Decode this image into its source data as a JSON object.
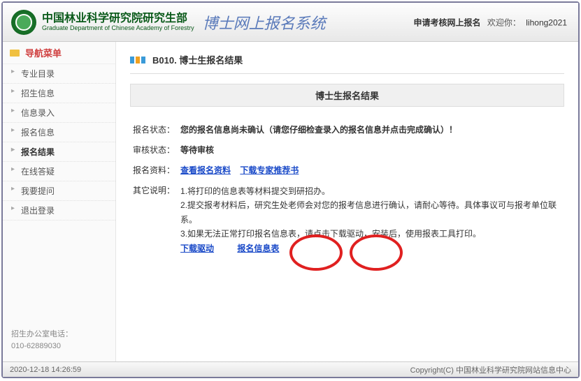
{
  "header": {
    "org_cn": "中国林业科学研究院研究生部",
    "org_en": "Graduate Department of Chinese Academy of Forestry",
    "system_name": "博士网上报名系统",
    "apply_label": "申请考核网上报名",
    "welcome_label": "欢迎你：",
    "username": "lihong2021"
  },
  "sidebar": {
    "nav_title": "导航菜单",
    "items": [
      {
        "label": "专业目录",
        "active": false
      },
      {
        "label": "招生信息",
        "active": false
      },
      {
        "label": "信息录入",
        "active": false
      },
      {
        "label": "报名信息",
        "active": false
      },
      {
        "label": "报名结果",
        "active": true
      },
      {
        "label": "在线答疑",
        "active": false
      },
      {
        "label": "我要提问",
        "active": false
      },
      {
        "label": "退出登录",
        "active": false
      }
    ],
    "office_label": "招生办公室电话：",
    "office_phone": "010-62889030"
  },
  "main": {
    "breadcrumb": "B010. 博士生报名结果",
    "section_title": "博士生报名结果",
    "rows": {
      "status_label": "报名状态：",
      "status_value": "您的报名信息尚未确认（请您仔细检查录入的报名信息并点击完成确认）！",
      "review_label": "审核状态：",
      "review_value": "等待审核",
      "material_label": "报名资料：",
      "material_link1": "查看报名资料",
      "material_link2": "下载专家推荐书",
      "notes_label": "其它说明：",
      "note1": "1.将打印的信息表等材料提交到研招办。",
      "note2": "2.提交报考材料后，研究生处老师会对您的报考信息进行确认，请耐心等待。具体事议可与报考单位联系。",
      "note3_prefix": "3.如果无法正常打印报名信息表，请点击下载驱动，安装后，使用报表工具打印。",
      "download_driver": "下载驱动",
      "info_form": "报名信息表"
    }
  },
  "footer": {
    "timestamp": "2020-12-18 14:26:59",
    "copyright": "Copyright(C) 中国林业科学研究院网站信息中心"
  }
}
